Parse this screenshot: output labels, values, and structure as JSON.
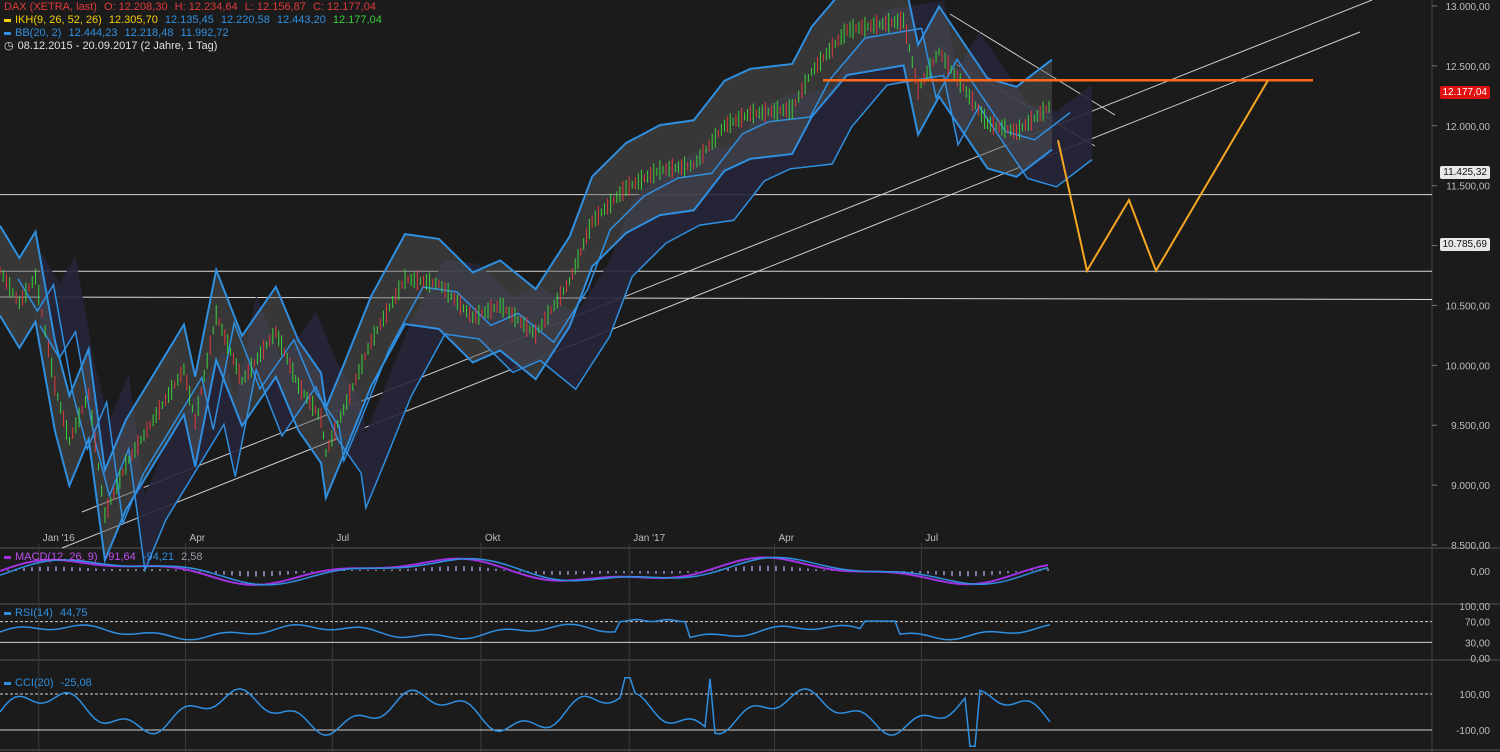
{
  "colors": {
    "background": "#1b1b1b",
    "bollinger": "#2f8fe0",
    "cloud": "#3a3a4a",
    "bull_candle": "#3ad13a",
    "bear_candle": "#e03a3a",
    "resistance": "#ff6a1a",
    "projection": "#f5a623",
    "macd": "#a032e0",
    "rsi": "#2f8fe0",
    "cci": "#2f8fe0",
    "cci_pos": "#3de03d",
    "cci_neg": "#e02020",
    "price_tag": "#e01010"
  },
  "legend": {
    "main": {
      "instrument": "DAX (XETRA, last)",
      "o": "O: 12.208,30",
      "h": "H: 12.234,64",
      "l": "L: 12.156,87",
      "c": "C: 12.177,04"
    },
    "ikh": {
      "label": "IKH(9, 26, 52, 26)",
      "v1": "12.305,70",
      "v2": "12.135,45",
      "v3": "12.220,58",
      "v4": "12.443,20",
      "v5": "12.177,04"
    },
    "bb": {
      "label": "BB(20, 2)",
      "v1": "12.444,23",
      "v2": "12.218,48",
      "v3": "11.992,72"
    },
    "period": "08.12.2015 - 20.09.2017  (2 Jahre, 1 Tag)"
  },
  "price_tags": {
    "last": "12.177,04",
    "level1": "11.425,32",
    "level2": "10.785,69"
  },
  "macd_legend": {
    "label": "MACD(12, 26, 9)",
    "v1": "-91,64",
    "v2": "-94,21",
    "v3": "2,58"
  },
  "rsi_legend": {
    "label": "RSI(14)",
    "value": "44,75"
  },
  "cci_legend": {
    "label": "CCI(20)",
    "value": "-25,08"
  },
  "chart_data": {
    "type": "line",
    "title": "DAX (XETRA, last)",
    "x_ticks": [
      "Jan '16",
      "Apr",
      "Jul",
      "Okt",
      "Jan '17",
      "Apr",
      "Jul"
    ],
    "y_ticks": [
      "13.000,00",
      "12.500,00",
      "12.000,00",
      "11.500,00",
      "11.000,00",
      "10.500,00",
      "10.000,00",
      "9.500,00",
      "9.000,00",
      "8.500,00"
    ],
    "ylim": [
      8500,
      13000
    ],
    "x_range": [
      "2015-12-08",
      "2017-09-20"
    ],
    "close_series": [
      {
        "date": "2015-12-08",
        "value": 10790
      },
      {
        "date": "2015-12-20",
        "value": 10520
      },
      {
        "date": "2015-12-30",
        "value": 10740
      },
      {
        "date": "2016-01-11",
        "value": 9830
      },
      {
        "date": "2016-01-20",
        "value": 9370
      },
      {
        "date": "2016-02-01",
        "value": 9760
      },
      {
        "date": "2016-02-11",
        "value": 8750
      },
      {
        "date": "2016-02-24",
        "value": 9170
      },
      {
        "date": "2016-03-10",
        "value": 9500
      },
      {
        "date": "2016-03-31",
        "value": 9965
      },
      {
        "date": "2016-04-07",
        "value": 9530
      },
      {
        "date": "2016-04-20",
        "value": 10420
      },
      {
        "date": "2016-05-06",
        "value": 9870
      },
      {
        "date": "2016-05-27",
        "value": 10280
      },
      {
        "date": "2016-06-10",
        "value": 9830
      },
      {
        "date": "2016-06-24",
        "value": 9560
      },
      {
        "date": "2016-06-27",
        "value": 9270
      },
      {
        "date": "2016-07-08",
        "value": 9630
      },
      {
        "date": "2016-07-25",
        "value": 10200
      },
      {
        "date": "2016-08-15",
        "value": 10720
      },
      {
        "date": "2016-09-05",
        "value": 10680
      },
      {
        "date": "2016-09-26",
        "value": 10400
      },
      {
        "date": "2016-10-13",
        "value": 10500
      },
      {
        "date": "2016-11-04",
        "value": 10260
      },
      {
        "date": "2016-11-25",
        "value": 10700
      },
      {
        "date": "2016-12-09",
        "value": 11200
      },
      {
        "date": "2016-12-30",
        "value": 11480
      },
      {
        "date": "2017-01-20",
        "value": 11630
      },
      {
        "date": "2017-02-10",
        "value": 11670
      },
      {
        "date": "2017-03-01",
        "value": 12000
      },
      {
        "date": "2017-03-17",
        "value": 12100
      },
      {
        "date": "2017-04-12",
        "value": 12140
      },
      {
        "date": "2017-04-24",
        "value": 12450
      },
      {
        "date": "2017-05-16",
        "value": 12800
      },
      {
        "date": "2017-06-20",
        "value": 12880
      },
      {
        "date": "2017-06-29",
        "value": 12300
      },
      {
        "date": "2017-07-12",
        "value": 12620
      },
      {
        "date": "2017-08-11",
        "value": 12020
      },
      {
        "date": "2017-08-29",
        "value": 11950
      },
      {
        "date": "2017-09-20",
        "value": 12177
      }
    ],
    "horizontal_levels": [
      11425.32,
      10785.69,
      10500,
      12380
    ],
    "projection": [
      {
        "date": "2017-09-20",
        "value": 11880
      },
      {
        "date": "2017-10-12",
        "value": 10790
      },
      {
        "date": "2017-11-01",
        "value": 11380
      },
      {
        "date": "2017-11-20",
        "value": 10790
      },
      {
        "date": "2018-01-20",
        "value": 12380
      }
    ],
    "macd": {
      "ylim": [
        -300,
        300
      ],
      "ticks": [
        "0,00"
      ]
    },
    "rsi": {
      "ylim": [
        0,
        100
      ],
      "ticks": [
        "100,00",
        "70,00",
        "30,00",
        "0,00"
      ],
      "levels": [
        70,
        30
      ]
    },
    "cci": {
      "ylim": [
        -200,
        200
      ],
      "ticks": [
        "100,00",
        "-100,00"
      ],
      "levels": [
        100,
        -100
      ]
    }
  }
}
